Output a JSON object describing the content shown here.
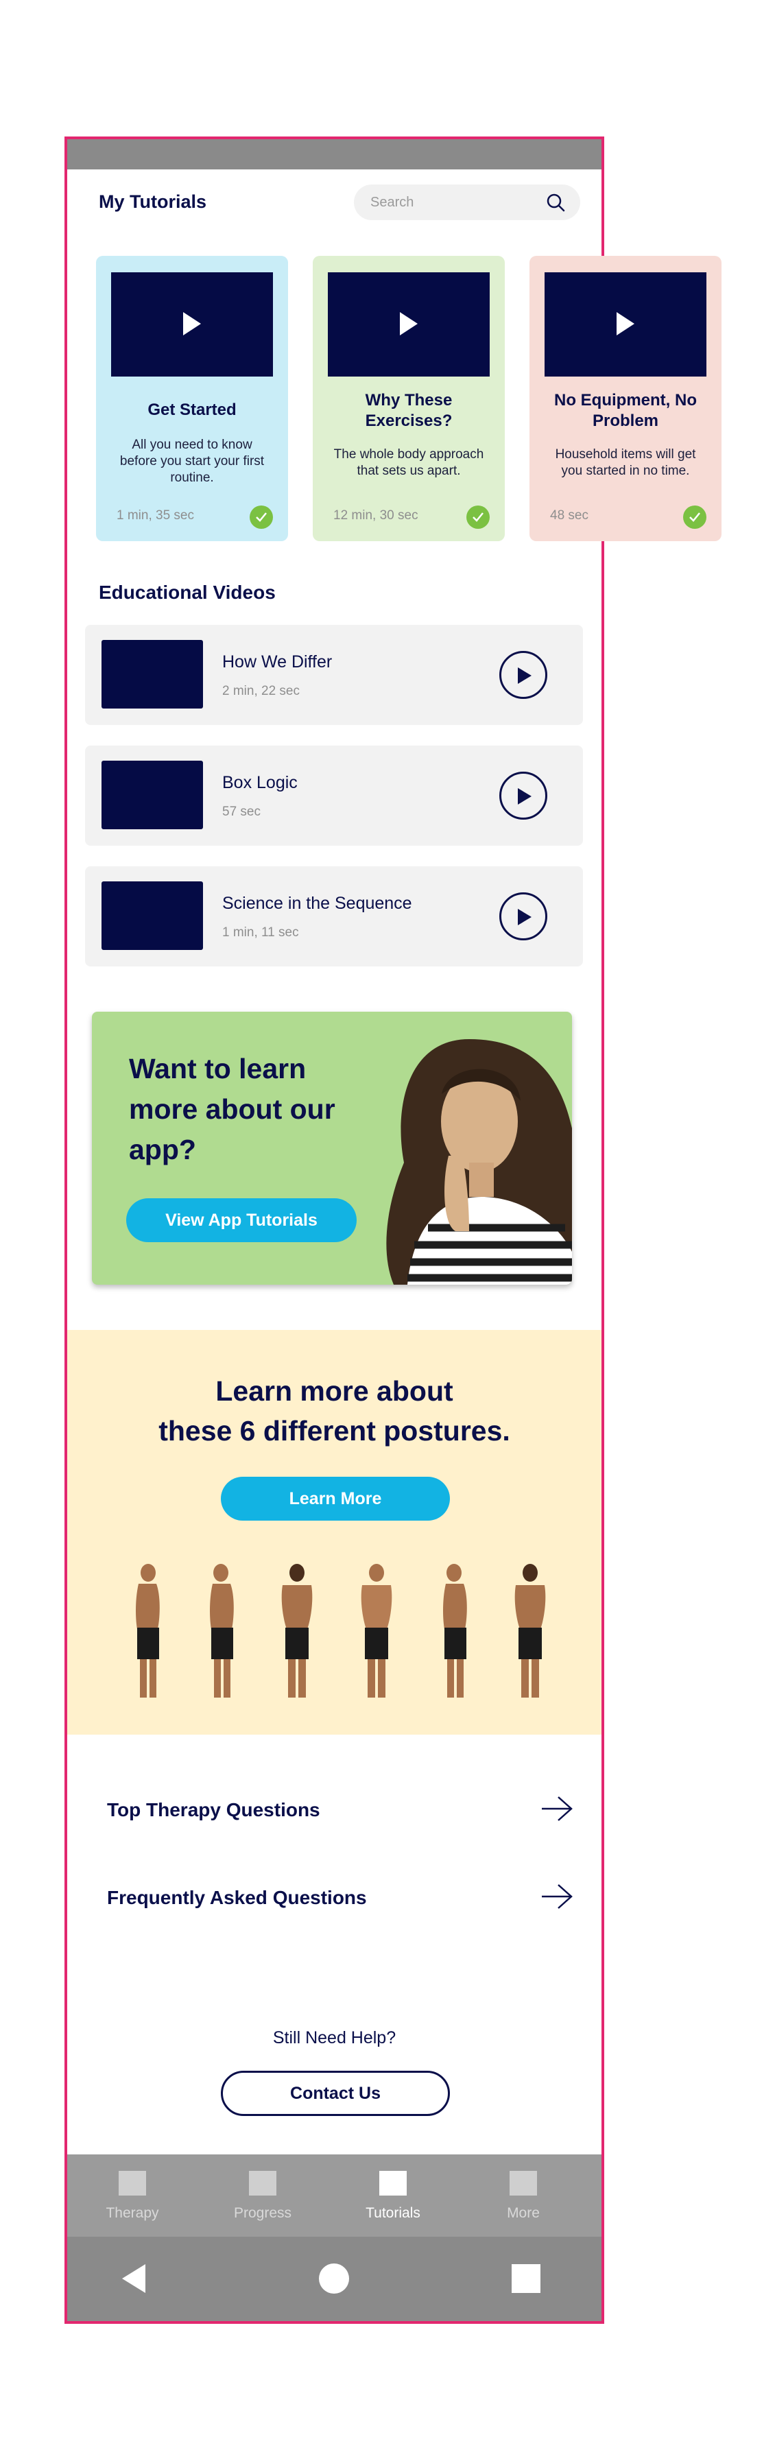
{
  "header": {
    "title": "My Tutorials",
    "search_placeholder": "Search"
  },
  "cards": [
    {
      "title": "Get Started",
      "description": "All you need to know before you start your first routine.",
      "duration": "1 min, 35 sec",
      "bg": "#c9edf7"
    },
    {
      "title": "Why These Exercises?",
      "description": "The whole body approach that sets us apart.",
      "duration": "12 min, 30 sec",
      "bg": "#dff0d0"
    },
    {
      "title": "No Equipment, No Problem",
      "description": "Household items will get you started in no time.",
      "duration": "48 sec",
      "bg": "#f7dcd6"
    }
  ],
  "educational": {
    "title": "Educational Videos",
    "videos": [
      {
        "title": "How We Differ",
        "duration": "2 min, 22 sec"
      },
      {
        "title": "Box Logic",
        "duration": "57 sec"
      },
      {
        "title": "Science in the Sequence",
        "duration": "1 min, 11 sec"
      }
    ]
  },
  "promo": {
    "heading": "Want to learn more about our app?",
    "button": "View App Tutorials"
  },
  "postures": {
    "heading_line1": "Learn more about",
    "heading_line2": "these 6 different postures.",
    "button": "Learn More"
  },
  "links": [
    {
      "label": "Top Therapy Questions"
    },
    {
      "label": "Frequently Asked Questions"
    }
  ],
  "help": {
    "text": "Still Need Help?",
    "button": "Contact Us"
  },
  "tabs": [
    {
      "label": "Therapy",
      "active": false
    },
    {
      "label": "Progress",
      "active": false
    },
    {
      "label": "Tutorials",
      "active": true
    },
    {
      "label": "More",
      "active": false
    }
  ],
  "colors": {
    "accent": "#12b3e3",
    "navy": "#0a0f4a",
    "frame": "#e2276f",
    "check": "#7bc142"
  }
}
